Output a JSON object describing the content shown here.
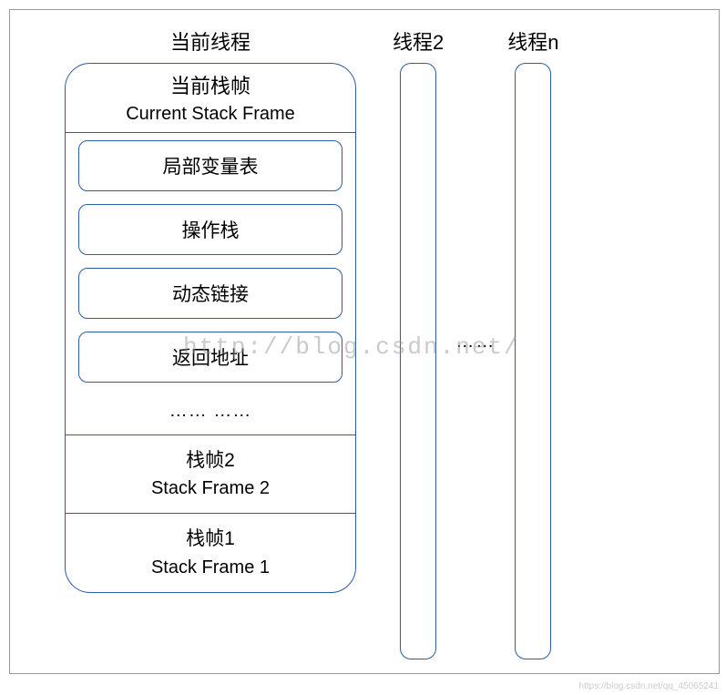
{
  "threads": {
    "current": {
      "label": "当前线程",
      "currentFrame": {
        "titleCn": "当前栈帧",
        "titleEn": "Current Stack Frame",
        "items": [
          "局部变量表",
          "操作栈",
          "动态链接",
          "返回地址"
        ],
        "ellipsis": "…… ……"
      },
      "frame2": {
        "titleCn": "栈帧2",
        "titleEn": "Stack Frame 2"
      },
      "frame1": {
        "titleCn": "栈帧1",
        "titleEn": "Stack Frame 1"
      }
    },
    "thread2": {
      "label": "线程2"
    },
    "threadN": {
      "label": "线程n"
    },
    "betweenDots": "……"
  },
  "watermark": "http://blog.csdn.net/",
  "cornerMark": "https://blog.csdn.net/qq_45065241"
}
